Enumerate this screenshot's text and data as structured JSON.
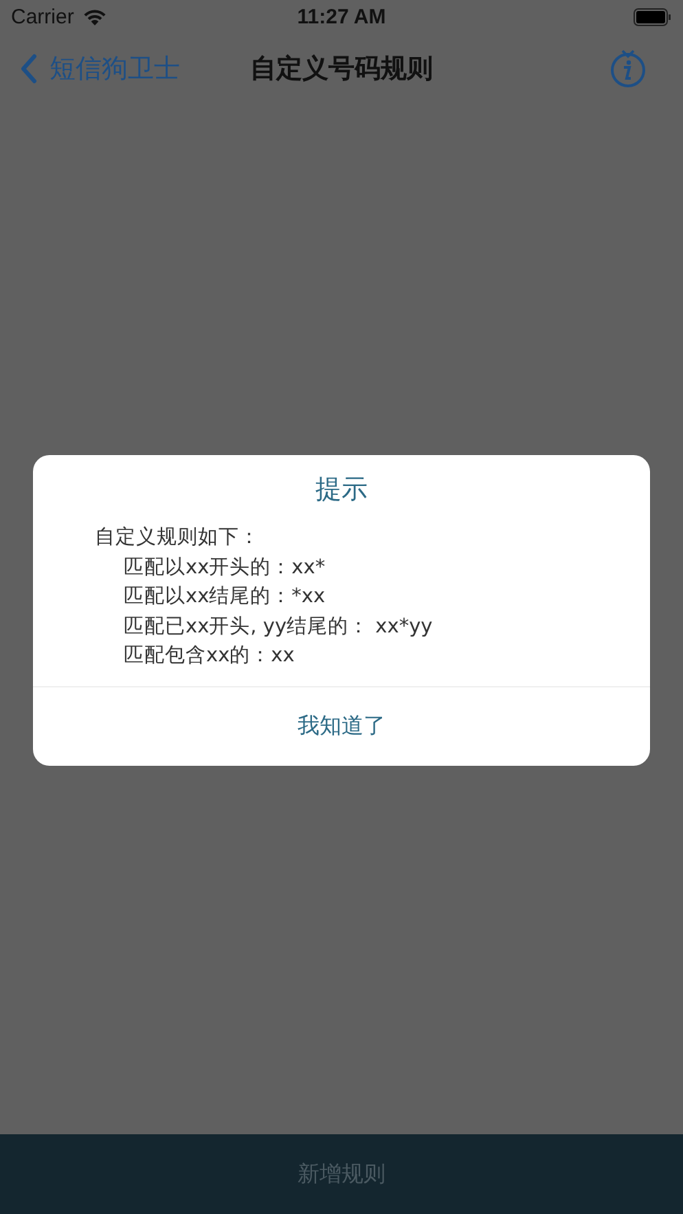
{
  "status_bar": {
    "carrier": "Carrier",
    "time": "11:27 AM"
  },
  "nav": {
    "back_label": "短信狗卫士",
    "title": "自定义号码规则"
  },
  "dialog": {
    "title": "提示",
    "heading": "自定义规则如下：",
    "rules": [
      "匹配以xx开头的：xx*",
      "匹配以xx结尾的：*xx",
      "匹配已xx开头, yy结尾的：  xx*yy",
      "匹配包含xx的：xx"
    ],
    "button": "我知道了"
  },
  "bottom_button": "新增规则"
}
